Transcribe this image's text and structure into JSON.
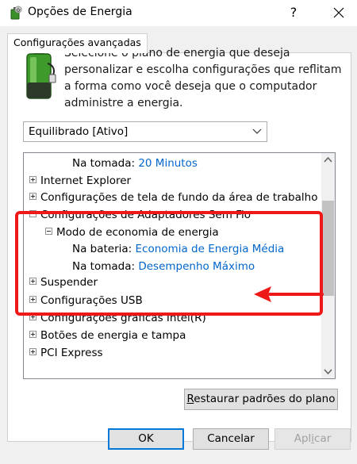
{
  "window": {
    "title": "Opções de Energia",
    "help_glyph": "?"
  },
  "tabs": [
    {
      "label": "Configurações avançadas",
      "active": true
    }
  ],
  "intro_text": "Selecione o plano de energia que deseja personalizar e escolha configurações que reflitam a forma como você deseja que o computador administre a energia.",
  "plan_select": {
    "value": "Equilibrado [Ativo]"
  },
  "tree": {
    "rows": [
      {
        "label": "Na tomada:",
        "value": "20 Minutos"
      },
      {
        "label": "Internet Explorer"
      },
      {
        "label": "Configurações de tela de fundo da área de trabalho"
      },
      {
        "label": "Configurações de Adaptadores Sem Fio"
      },
      {
        "label": "Modo de economia de energia"
      },
      {
        "label": "Na bateria:",
        "value": "Economia de Energia Média"
      },
      {
        "label": "Na tomada:",
        "value": "Desempenho Máximo"
      },
      {
        "label": "Suspender"
      },
      {
        "label": "Configurações USB"
      },
      {
        "label": "Configurações gráficas Intel(R)"
      },
      {
        "label": "Botões de energia e tampa"
      },
      {
        "label": "PCI Express"
      }
    ]
  },
  "buttons": {
    "restore": {
      "label_u": "R",
      "label_rest": "estaurar padrões do plano"
    },
    "ok": "OK",
    "cancel": "Cancelar",
    "apply": {
      "label_pre": "Apl",
      "label_u": "i",
      "label_rest": "car"
    }
  },
  "colors": {
    "value_link": "#0066cc",
    "highlight": "#ef1818",
    "accent": "#0078d7"
  }
}
